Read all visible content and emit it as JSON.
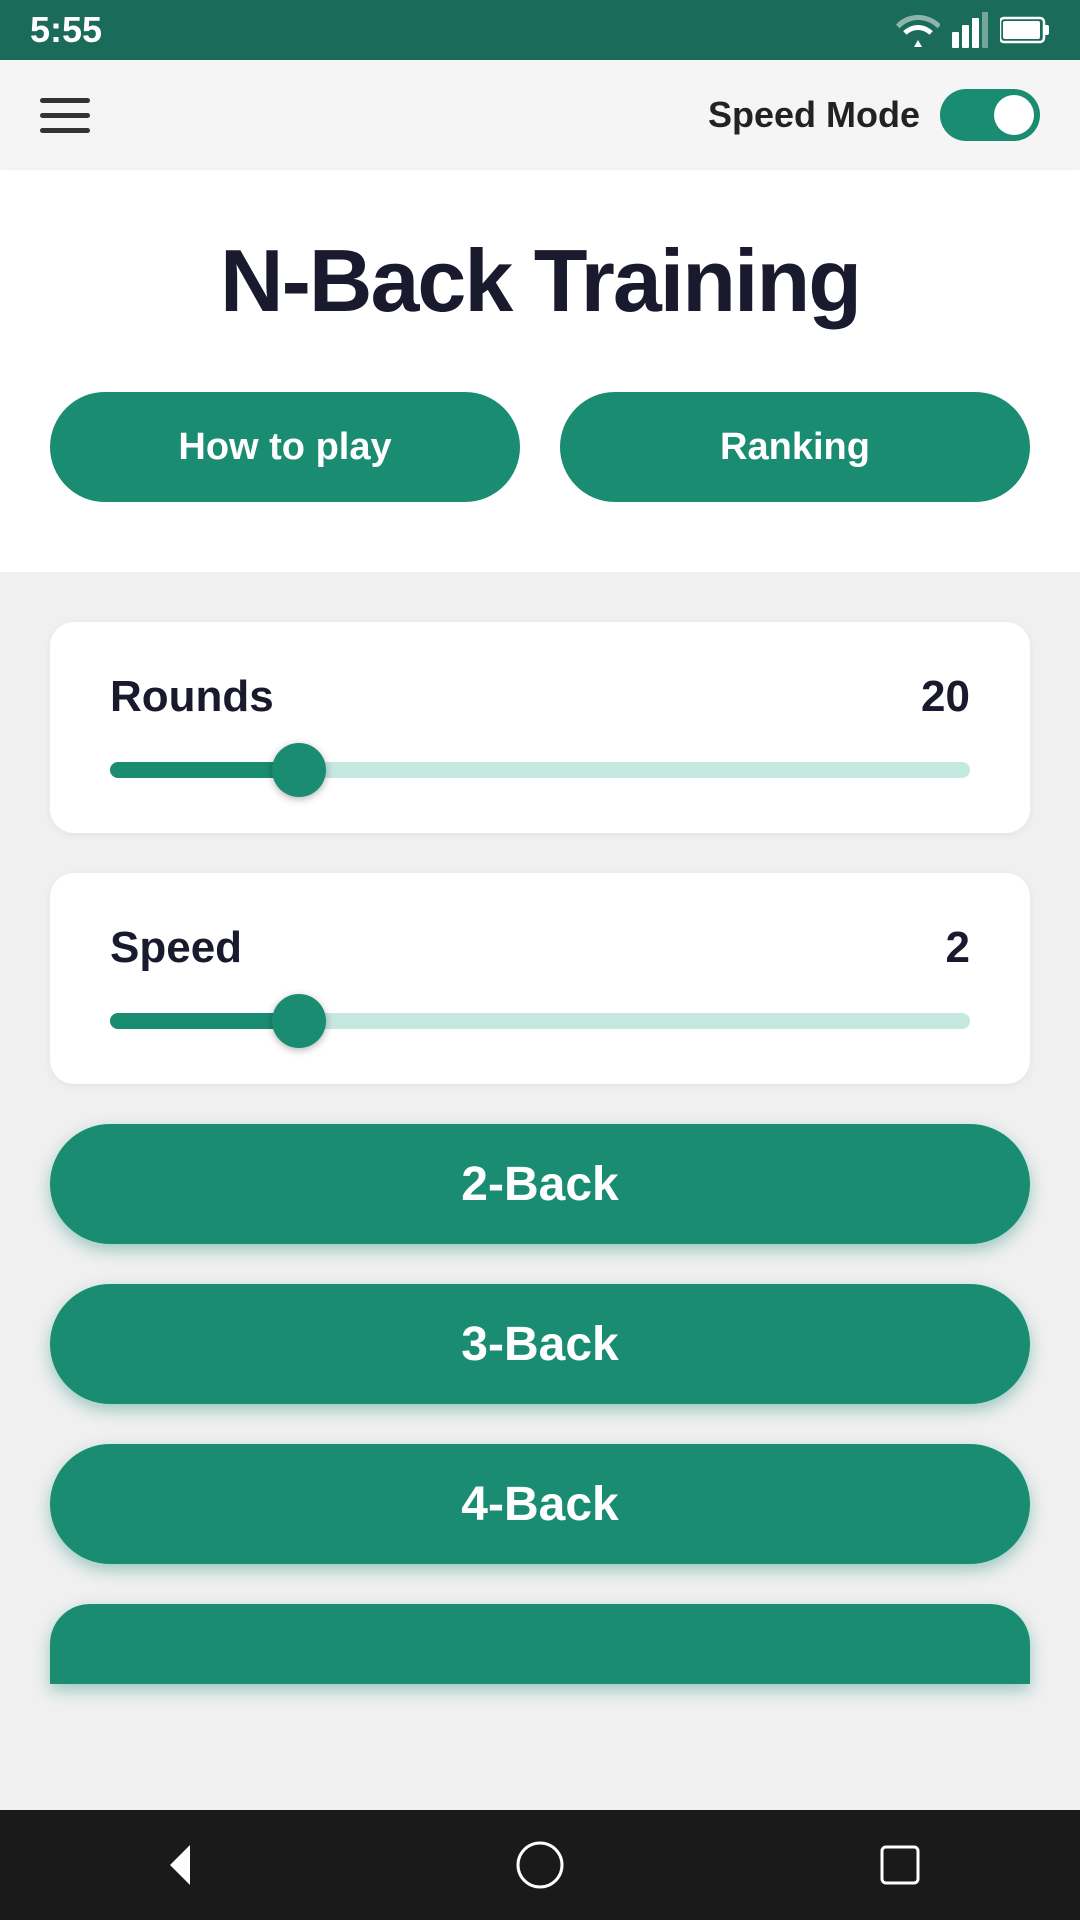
{
  "status_bar": {
    "time": "5:55"
  },
  "top_bar": {
    "speed_mode_label": "Speed Mode"
  },
  "hero": {
    "title": "N-Back Training",
    "how_to_play_btn": "How to play",
    "ranking_btn": "Ranking"
  },
  "rounds_slider": {
    "label": "Rounds",
    "value": "20",
    "fill_percent": 22
  },
  "speed_slider": {
    "label": "Speed",
    "value": "2",
    "fill_percent": 22
  },
  "game_buttons": [
    {
      "label": "2-Back",
      "name": "two-back-button"
    },
    {
      "label": "3-Back",
      "name": "three-back-button"
    },
    {
      "label": "4-Back",
      "name": "four-back-button"
    }
  ],
  "nav": {
    "back_label": "back",
    "home_label": "home",
    "recents_label": "recents"
  }
}
